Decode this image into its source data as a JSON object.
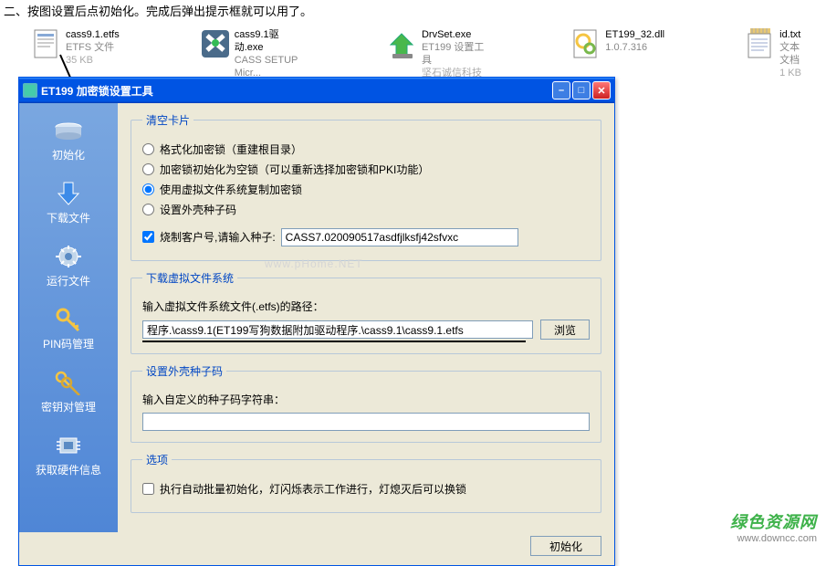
{
  "instruction": "二、按图设置后点初始化。完成后弹出提示框就可以用了。",
  "files": [
    {
      "line1": "cass9.1.etfs",
      "line2": "ETFS 文件",
      "line3": "35 KB"
    },
    {
      "line1": "cass9.1驱动.exe",
      "line2": "CASS SETUP  Micr...",
      "line3": ""
    },
    {
      "line1": "DrvSet.exe",
      "line2": "ET199 设置工具",
      "line3": "坚石诚信科技有限..."
    },
    {
      "line1": "ET199_32.dll",
      "line2": "1.0.7.316",
      "line3": ""
    },
    {
      "line1": "id.txt",
      "line2": "文本文档",
      "line3": "1 KB"
    }
  ],
  "dialog": {
    "title": "ET199 加密锁设置工具",
    "sidebar": [
      {
        "label": "初始化"
      },
      {
        "label": "下载文件"
      },
      {
        "label": "运行文件"
      },
      {
        "label": "PIN码管理"
      },
      {
        "label": "密钥对管理"
      },
      {
        "label": "获取硬件信息"
      }
    ],
    "fieldset1": {
      "legend": "清空卡片",
      "r1": "格式化加密锁（重建根目录）",
      "r2": "加密锁初始化为空锁（可以重新选择加密锁和PKI功能）",
      "r3": "使用虚拟文件系统复制加密锁",
      "r4": "设置外壳种子码",
      "chk1": "烧制客户号,请输入种子:",
      "seed": "CASS7.020090517asdfjlksfj42sfvxc"
    },
    "fieldset2": {
      "legend": "下载虚拟文件系统",
      "label": "输入虚拟文件系统文件(.etfs)的路径：",
      "path": "程序.\\cass9.1(ET199写狗数据附加驱动程序.\\cass9.1\\cass9.1.etfs",
      "browse": "浏览"
    },
    "fieldset3": {
      "legend": "设置外壳种子码",
      "label": "输入自定义的种子码字符串：",
      "value": ""
    },
    "fieldset4": {
      "legend": "选项",
      "chk": "执行自动批量初始化，灯闪烁表示工作进行，灯熄灭后可以换锁"
    },
    "initBtn": "初始化"
  },
  "watermark": {
    "l1": "绿色资源网",
    "l2": "www.downcc.com"
  },
  "phome": "www.pHome.NET"
}
